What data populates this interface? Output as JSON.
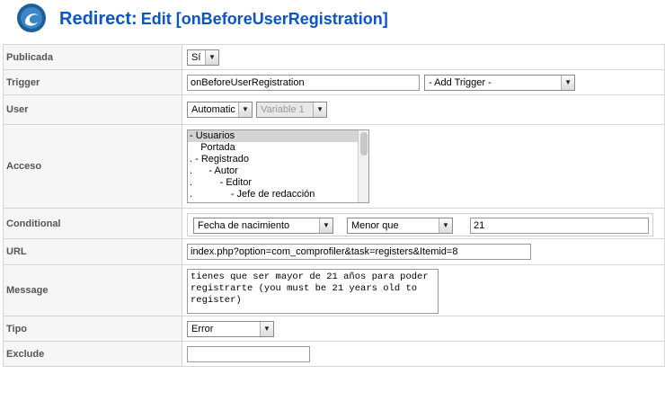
{
  "header": {
    "title": "Redirect:",
    "subtitle": "Edit [onBeforeUserRegistration]"
  },
  "fields": {
    "publicada": {
      "label": "Publicada",
      "value": "Sí"
    },
    "trigger": {
      "label": "Trigger",
      "value": "onBeforeUserRegistration",
      "add_trigger": "- Add Trigger -"
    },
    "user": {
      "label": "User",
      "type_value": "Automatic",
      "variable_value": "Variable 1"
    },
    "acceso": {
      "label": "Acceso",
      "items": [
        "- Usuarios",
        "    Portada",
        ". - Registrado",
        ".      - Autor",
        ".          - Editor",
        ".              - Jefe de redacción"
      ]
    },
    "conditional": {
      "label": "Conditional",
      "field": "Fecha de nacimiento",
      "operator": "Menor que",
      "value": "21"
    },
    "url": {
      "label": "URL",
      "value": "index.php?option=com_comprofiler&task=registers&Itemid=8"
    },
    "message": {
      "label": "Message",
      "value": "tienes que ser mayor de 21 años para poder registrarte (you must be 21 years old to register)"
    },
    "tipo": {
      "label": "Tipo",
      "value": "Error"
    },
    "exclude": {
      "label": "Exclude",
      "value": ""
    }
  },
  "colors": {
    "title": "#0b55c4",
    "label_bg": "#f6f6f6",
    "border": "#d5d5d5"
  }
}
